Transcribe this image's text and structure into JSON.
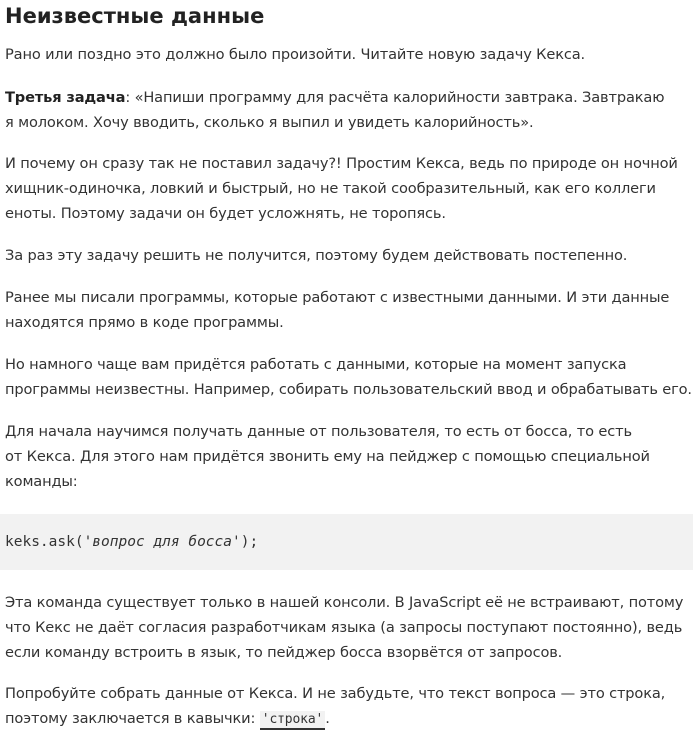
{
  "title": "Неизвестные данные",
  "paragraphs": {
    "p1": "Рано или поздно это должно было произойти. Читайте новую задачу Кекса.",
    "p2_bold": "Третья задача",
    "p2_line1": ": «Напиши программу для расчёта калорийности завтрака. Завтракаю",
    "p2_line2": "я молоком. Хочу вводить, сколько я выпил и увидеть калорийность».",
    "p3_line1": "И почему он сразу так не поставил задачу?! Простим Кекса, ведь по природе он ночной",
    "p3_line2": "хищник-одиночка, ловкий и быстрый, но не такой сообразительный, как его коллеги",
    "p3_line3": "еноты. Поэтому задачи он будет усложнять, не торопясь.",
    "p4": "За раз эту задачу решить не получится, поэтому будем действовать постепенно.",
    "p5_line1": "Ранее мы писали программы, которые работают с известными данными. И эти данные",
    "p5_line2": "находятся прямо в коде программы.",
    "p6_line1": "Но намного чаще вам придётся работать с данными, которые на момент запуска",
    "p6_line2": "программы неизвестны. Например, собирать пользовательский ввод и обрабатывать его.",
    "p7_line1": "Для начала научимся получать данные от пользователя, то есть от босса, то есть",
    "p7_line2": "от Кекса. Для этого нам придётся звонить ему на пейджер с помощью специальной",
    "p7_line3": "команды:",
    "p8_line1": "Эта команда существует только в нашей консоли. В JavaScript её не встраивают, потому",
    "p8_line2": "что Кекс не даёт согласия разработчикам языка (а запросы поступают постоянно), ведь",
    "p8_line3": "если команду встроить в язык, то пейджер босса взорвётся от запросов.",
    "p9_line1": "Попробуйте собрать данные от Кекса. И не забудьте, что текст вопроса — это строка,",
    "p9_line2_prefix": "поэтому заключается в кавычки: ",
    "p9_inline_code": "'строка'",
    "p9_line2_suffix": "."
  },
  "code": {
    "prefix": "keks.ask(",
    "string": "'вопрос для босса'",
    "suffix": ");"
  },
  "colors": {
    "text": "#333333",
    "heading": "#222222",
    "code_background": "#f2f2f2"
  }
}
